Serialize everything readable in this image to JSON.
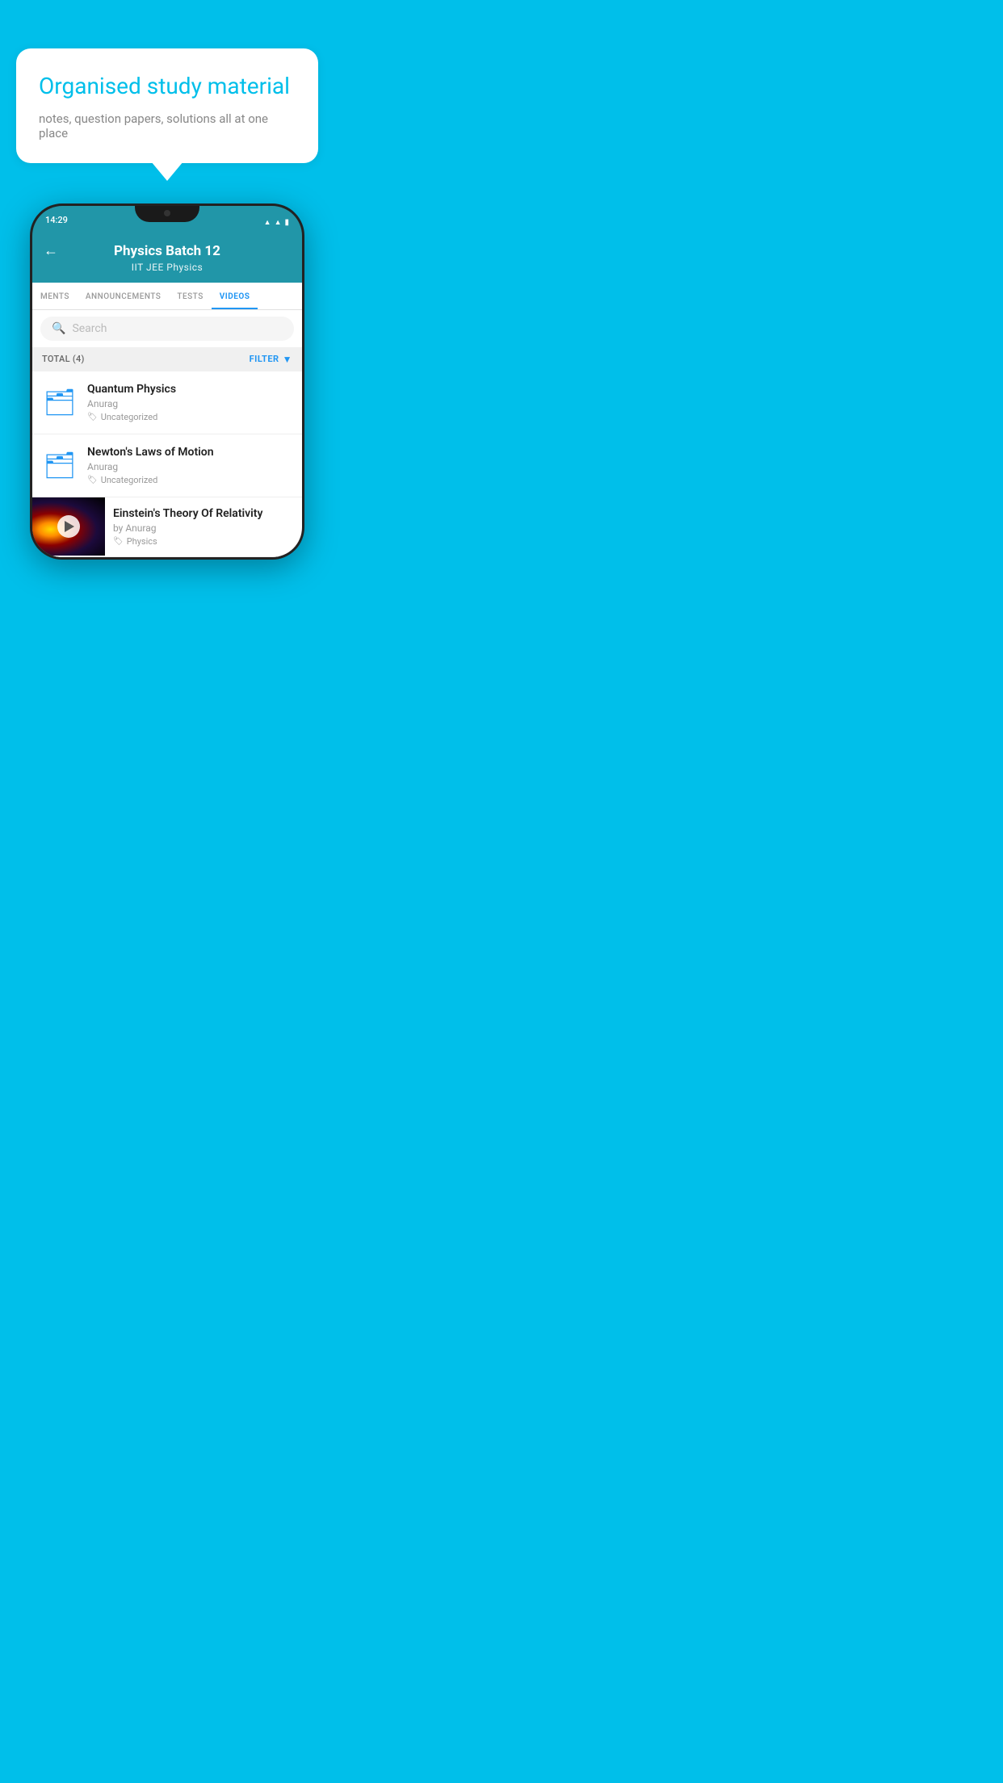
{
  "promo": {
    "title": "Organised study material",
    "subtitle": "notes, question papers, solutions all at one place"
  },
  "phone": {
    "status_time": "14:29"
  },
  "header": {
    "title": "Physics Batch 12",
    "subtitle": "IIT JEE   Physics",
    "back_label": "←"
  },
  "tabs": [
    {
      "label": "MENTS",
      "active": false
    },
    {
      "label": "ANNOUNCEMENTS",
      "active": false
    },
    {
      "label": "TESTS",
      "active": false
    },
    {
      "label": "VIDEOS",
      "active": true
    }
  ],
  "search": {
    "placeholder": "Search"
  },
  "filter_bar": {
    "total_label": "TOTAL (4)",
    "filter_label": "FILTER"
  },
  "videos": [
    {
      "type": "folder",
      "title": "Quantum Physics",
      "author": "Anurag",
      "tag": "Uncategorized"
    },
    {
      "type": "folder",
      "title": "Newton's Laws of Motion",
      "author": "Anurag",
      "tag": "Uncategorized"
    },
    {
      "type": "video",
      "title": "Einstein's Theory Of Relativity",
      "author": "by Anurag",
      "tag": "Physics"
    }
  ]
}
